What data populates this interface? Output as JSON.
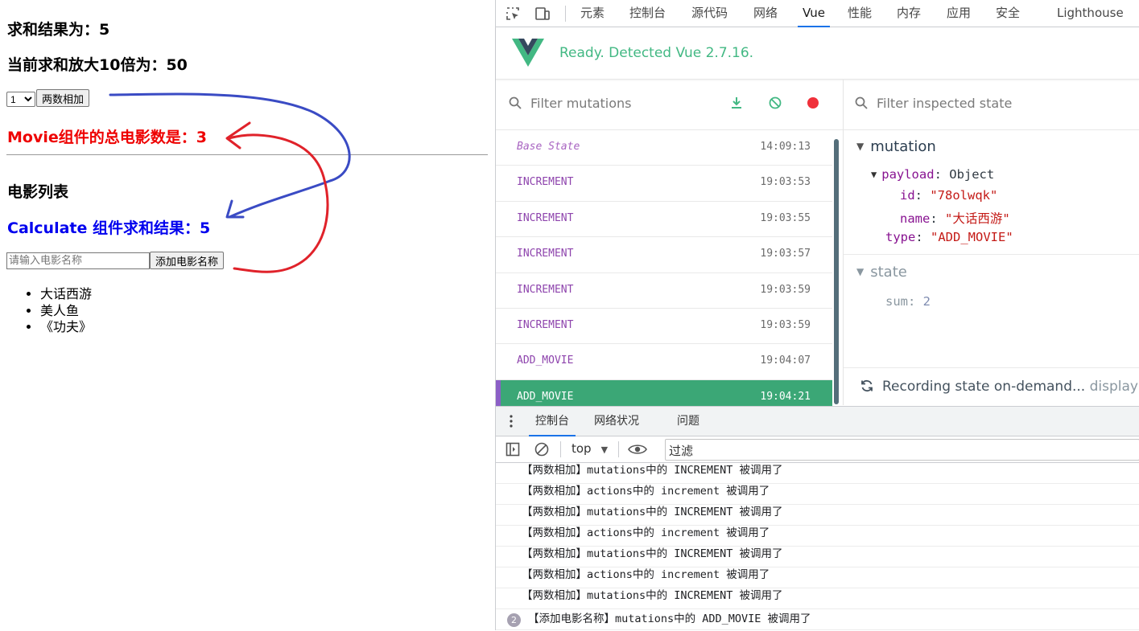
{
  "page": {
    "sum_text": "求和结果为：5",
    "magnified_text": "当前求和放大10倍为：50",
    "select_value": "1",
    "add_button": "两数相加",
    "movie_total": "Movie组件的总电影数是：3",
    "movie_list_title": "电影列表",
    "calc_result": "Calculate 组件求和结果：5",
    "movie_input_placeholder": "请输入电影名称",
    "add_movie_button": "添加电影名称",
    "movies": [
      "大话西游",
      "美人鱼",
      "《功夫》"
    ],
    "annotation_colors": {
      "blue_arrow": "#3a4bc4",
      "red_arrow": "#e0222a"
    }
  },
  "devtools": {
    "tabs": [
      "元素",
      "控制台",
      "源代码",
      "网络",
      "Vue",
      "性能",
      "内存",
      "应用",
      "安全",
      "Lighthouse"
    ],
    "active_tab": "Vue",
    "vue": {
      "status": "Ready. Detected Vue 2.7.16.",
      "filter_mutations_placeholder": "Filter mutations",
      "filter_state_placeholder": "Filter inspected state",
      "mutations": [
        {
          "name": "Base State",
          "time": "14:09:13"
        },
        {
          "name": "INCREMENT",
          "time": "19:03:53"
        },
        {
          "name": "INCREMENT",
          "time": "19:03:55"
        },
        {
          "name": "INCREMENT",
          "time": "19:03:57"
        },
        {
          "name": "INCREMENT",
          "time": "19:03:59"
        },
        {
          "name": "INCREMENT",
          "time": "19:03:59"
        },
        {
          "name": "ADD_MOVIE",
          "time": "19:04:07"
        },
        {
          "name": "ADD_MOVIE",
          "time": "19:04:21"
        }
      ],
      "selected_mutation": 7,
      "inspector": {
        "mutation_label": "mutation",
        "payload_key": "payload",
        "payload_type": "Object",
        "id_key": "id",
        "id_value": "\"78olwqk\"",
        "name_key": "name",
        "name_value": "\"大话西游\"",
        "type_key": "type",
        "type_value": "\"ADD_MOVIE\"",
        "state_label": "state",
        "sum_key": "sum",
        "sum_value": "2"
      },
      "recording_text": "Recording state on-demand...",
      "recording_suffix": "displaying"
    },
    "drawer": {
      "tabs": [
        "控制台",
        "网络状况",
        "问题"
      ],
      "active_tab": "控制台",
      "context": "top",
      "filter_placeholder": "过滤",
      "logs": [
        "【两数相加】mutations中的 INCREMENT 被调用了",
        "【两数相加】actions中的 increment 被调用了",
        "【两数相加】mutations中的 INCREMENT 被调用了",
        "【两数相加】actions中的 increment 被调用了",
        "【两数相加】mutations中的 INCREMENT 被调用了",
        "【两数相加】actions中的 increment 被调用了",
        "【两数相加】mutations中的 INCREMENT 被调用了"
      ],
      "last_log": {
        "count": "2",
        "text": "【添加电影名称】mutations中的 ADD_MOVIE 被调用了"
      }
    },
    "colors": {
      "vue_green": "#42b883",
      "selected_row": "#3ba776",
      "record_red": "#f0303a"
    }
  }
}
